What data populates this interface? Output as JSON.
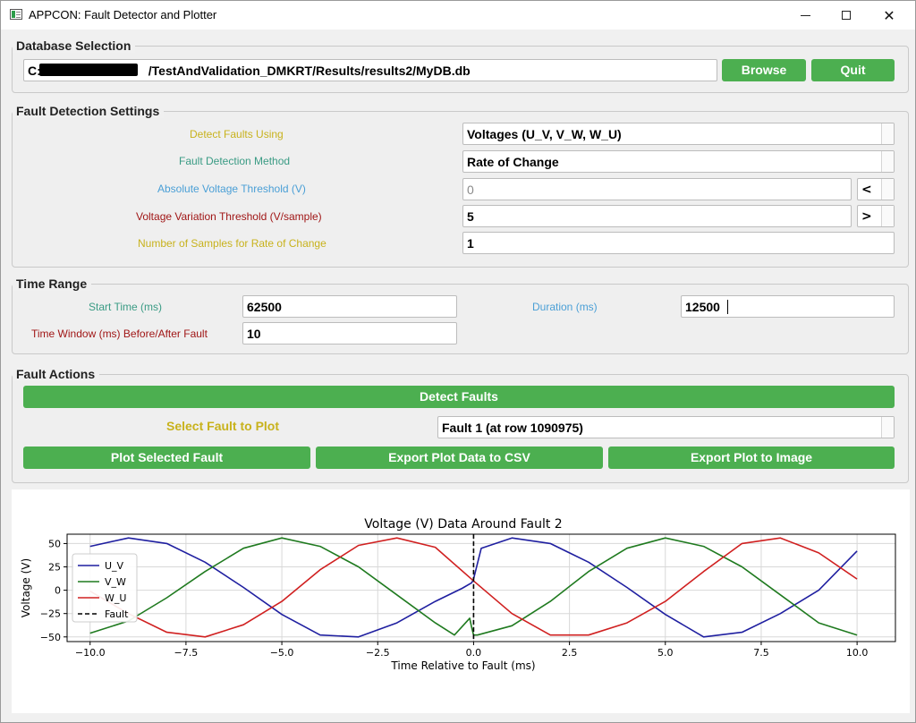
{
  "window": {
    "title": "APPCON: Fault Detector and Plotter"
  },
  "database": {
    "legend": "Database Selection",
    "path": "C:/                    /TestAndValidation_DMKRT/Results/results2/MyDB.db",
    "path_prefix": "C:",
    "path_suffix": "/TestAndValidation_DMKRT/Results/results2/MyDB.db",
    "browse_label": "Browse",
    "quit_label": "Quit"
  },
  "settings": {
    "legend": "Fault Detection Settings",
    "detect_using_label": "Detect Faults Using",
    "detect_using_value": "Voltages (U_V, V_W, W_U)",
    "method_label": "Fault Detection Method",
    "method_value": "Rate of Change",
    "abs_threshold_label": "Absolute Voltage Threshold (V)",
    "abs_threshold_value": "0",
    "abs_operator": "<",
    "var_threshold_label": "Voltage Variation Threshold (V/sample)",
    "var_threshold_value": "5",
    "var_operator": ">",
    "samples_label": "Number of Samples for Rate of Change",
    "samples_value": "1"
  },
  "time_range": {
    "legend": "Time Range",
    "start_label": "Start Time (ms)",
    "start_value": "62500",
    "duration_label": "Duration (ms)",
    "duration_value": "12500",
    "window_label": "Time Window (ms) Before/After Fault",
    "window_value": "10"
  },
  "actions": {
    "legend": "Fault Actions",
    "detect_label": "Detect Faults",
    "select_label": "Select Fault to Plot",
    "select_value": "Fault 1 (at row 1090975)",
    "plot_label": "Plot Selected Fault",
    "export_csv_label": "Export Plot Data to CSV",
    "export_image_label": "Export Plot to Image"
  },
  "colors": {
    "accent_green": "#4caf50",
    "label_yellow": "#c8b21c",
    "label_teal": "#3a9b84",
    "label_blue": "#4a9fd6",
    "label_red": "#a01616"
  },
  "chart_data": {
    "type": "line",
    "title": "Voltage (V) Data Around Fault 2",
    "xlabel": "Time Relative to Fault (ms)",
    "ylabel": "Voltage (V)",
    "xlim": [
      -10.6,
      11.0
    ],
    "ylim": [
      -55,
      60
    ],
    "xticks": [
      -10.0,
      -7.5,
      -5.0,
      -2.5,
      0.0,
      2.5,
      5.0,
      7.5,
      10.0
    ],
    "xtick_labels": [
      "−10.0",
      "−7.5",
      "−5.0",
      "−2.5",
      "0.0",
      "2.5",
      "5.0",
      "7.5",
      "10.0"
    ],
    "yticks": [
      50,
      25,
      0,
      -25,
      -50
    ],
    "ytick_labels": [
      "50",
      "25",
      "0",
      "−25",
      "−50"
    ],
    "grid": true,
    "legend_position": "left",
    "fault_x": 0,
    "series": [
      {
        "name": "U_V",
        "color": "#1f1fa0",
        "x": [
          -10,
          -9,
          -8,
          -7,
          -6,
          -5,
          -4,
          -3,
          -2,
          -1,
          -0.3,
          -0.05,
          0,
          0.2,
          1,
          2,
          3,
          4,
          5,
          6,
          7,
          8,
          9,
          10
        ],
        "y": [
          47,
          56,
          50,
          30,
          3,
          -26,
          -48,
          -50,
          -35,
          -12,
          2,
          8,
          12,
          45,
          56,
          50,
          30,
          3,
          -26,
          -50,
          -45,
          -25,
          0,
          42
        ]
      },
      {
        "name": "V_W",
        "color": "#1f7a1f",
        "x": [
          -10,
          -9,
          -8,
          -7,
          -6,
          -5,
          -4,
          -3,
          -2,
          -1,
          -0.5,
          -0.1,
          -0.05,
          0,
          0.1,
          1,
          2,
          3,
          4,
          5,
          6,
          7,
          8,
          9,
          10
        ],
        "y": [
          -46,
          -33,
          -8,
          20,
          45,
          56,
          47,
          25,
          -5,
          -35,
          -48,
          -30,
          -40,
          -48,
          -48,
          -38,
          -12,
          20,
          45,
          56,
          47,
          25,
          -5,
          -35,
          -48
        ]
      },
      {
        "name": "W_U",
        "color": "#d02020",
        "x": [
          -10,
          -9,
          -8,
          -7,
          -6,
          -5,
          -4,
          -3,
          -2,
          -1,
          0,
          1,
          2,
          3,
          4,
          5,
          6,
          7,
          8,
          9,
          10
        ],
        "y": [
          -1,
          -25,
          -45,
          -50,
          -37,
          -12,
          22,
          48,
          56,
          46,
          10,
          -25,
          -48,
          -48,
          -35,
          -12,
          20,
          50,
          56,
          40,
          12
        ]
      },
      {
        "name": "Fault",
        "color": "#000000",
        "style": "dashed"
      }
    ]
  }
}
